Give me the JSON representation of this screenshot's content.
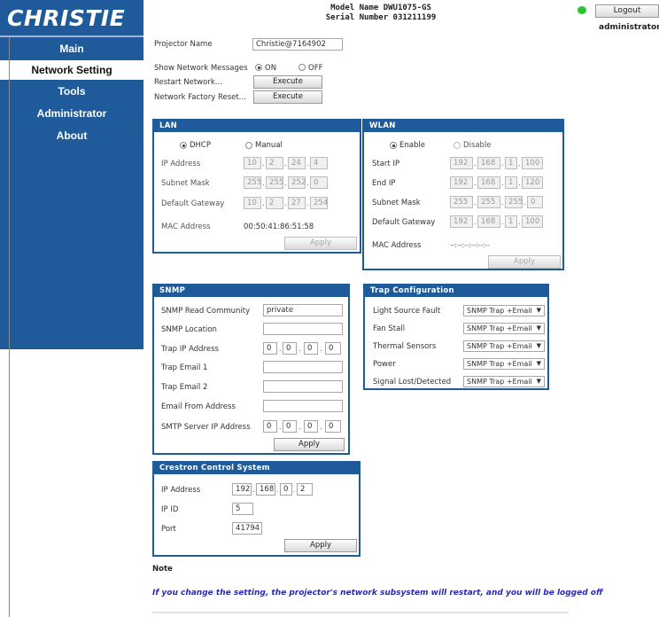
{
  "header": {
    "logo": "CHRISTIE",
    "model_line": "Model Name DWU1075-GS",
    "serial_line": "Serial Number 031211199",
    "logout_label": "Logout",
    "user": "administrator",
    "status_color": "#27c72c"
  },
  "sidebar": {
    "items": [
      {
        "label": "Main"
      },
      {
        "label": "Network Setting"
      },
      {
        "label": "Tools"
      },
      {
        "label": "Administrator"
      },
      {
        "label": "About"
      }
    ],
    "active": "Network Setting"
  },
  "general": {
    "projector_name_label": "Projector Name",
    "projector_name": "Christie@7164902",
    "show_messages_label": "Show Network Messages",
    "on_label": "ON",
    "off_label": "OFF",
    "restart_label": "Restart Network...",
    "factory_reset_label": "Network Factory Reset...",
    "execute_label": "Execute"
  },
  "lan": {
    "title": "LAN",
    "dhcp_label": "DHCP",
    "manual_label": "Manual",
    "ip_label": "IP Address",
    "ip": [
      "10",
      "2",
      "24",
      "4"
    ],
    "subnet_label": "Subnet Mask",
    "subnet": [
      "255",
      "255",
      "252",
      "0"
    ],
    "gateway_label": "Default Gateway",
    "gateway": [
      "10",
      "2",
      "27",
      "254"
    ],
    "mac_label": "MAC Address",
    "mac": "00:50:41:86:51:58",
    "apply_label": "Apply"
  },
  "wlan": {
    "title": "WLAN",
    "enable_label": "Enable",
    "disable_label": "Disable",
    "start_label": "Start IP",
    "start": [
      "192",
      "168",
      "1",
      "100"
    ],
    "end_label": "End IP",
    "end": [
      "192",
      "168",
      "1",
      "120"
    ],
    "subnet_label": "Subnet Mask",
    "subnet": [
      "255",
      "255",
      "255",
      "0"
    ],
    "gateway_label": "Default Gateway",
    "gateway": [
      "192",
      "168",
      "1",
      "100"
    ],
    "mac_label": "MAC Address",
    "mac": "--:--:--:--:--:--",
    "apply_label": "Apply"
  },
  "snmp": {
    "title": "SNMP",
    "community_label": "SNMP Read Community",
    "community": "private",
    "location_label": "SNMP Location",
    "trap_ip_label": "Trap IP Address",
    "trap_ip": [
      "0",
      "0",
      "0",
      "0"
    ],
    "email1_label": "Trap Email 1",
    "email2_label": "Trap Email 2",
    "from_label": "Email From Address",
    "smtp_label": "SMTP Server IP Address",
    "smtp_ip": [
      "0",
      "0",
      "0",
      "0"
    ],
    "apply_label": "Apply"
  },
  "trap": {
    "title": "Trap Configuration",
    "rows": [
      {
        "label": "Light Source Fault",
        "value": "SNMP Trap +Email"
      },
      {
        "label": "Fan Stall",
        "value": "SNMP Trap +Email"
      },
      {
        "label": "Thermal Sensors",
        "value": "SNMP Trap +Email"
      },
      {
        "label": "Power",
        "value": "SNMP Trap +Email"
      },
      {
        "label": "Signal Lost/Detected",
        "value": "SNMP Trap +Email"
      }
    ]
  },
  "crestron": {
    "title": "Crestron Control System",
    "ip_label": "IP Address",
    "ip": [
      "192",
      "168",
      "0",
      "2"
    ],
    "ipid_label": "IP ID",
    "ipid": "5",
    "port_label": "Port",
    "port": "41794",
    "apply_label": "Apply"
  },
  "note": {
    "title": "Note",
    "text": "If you change the setting, the projector's network subsystem will restart, and you will be logged off"
  }
}
